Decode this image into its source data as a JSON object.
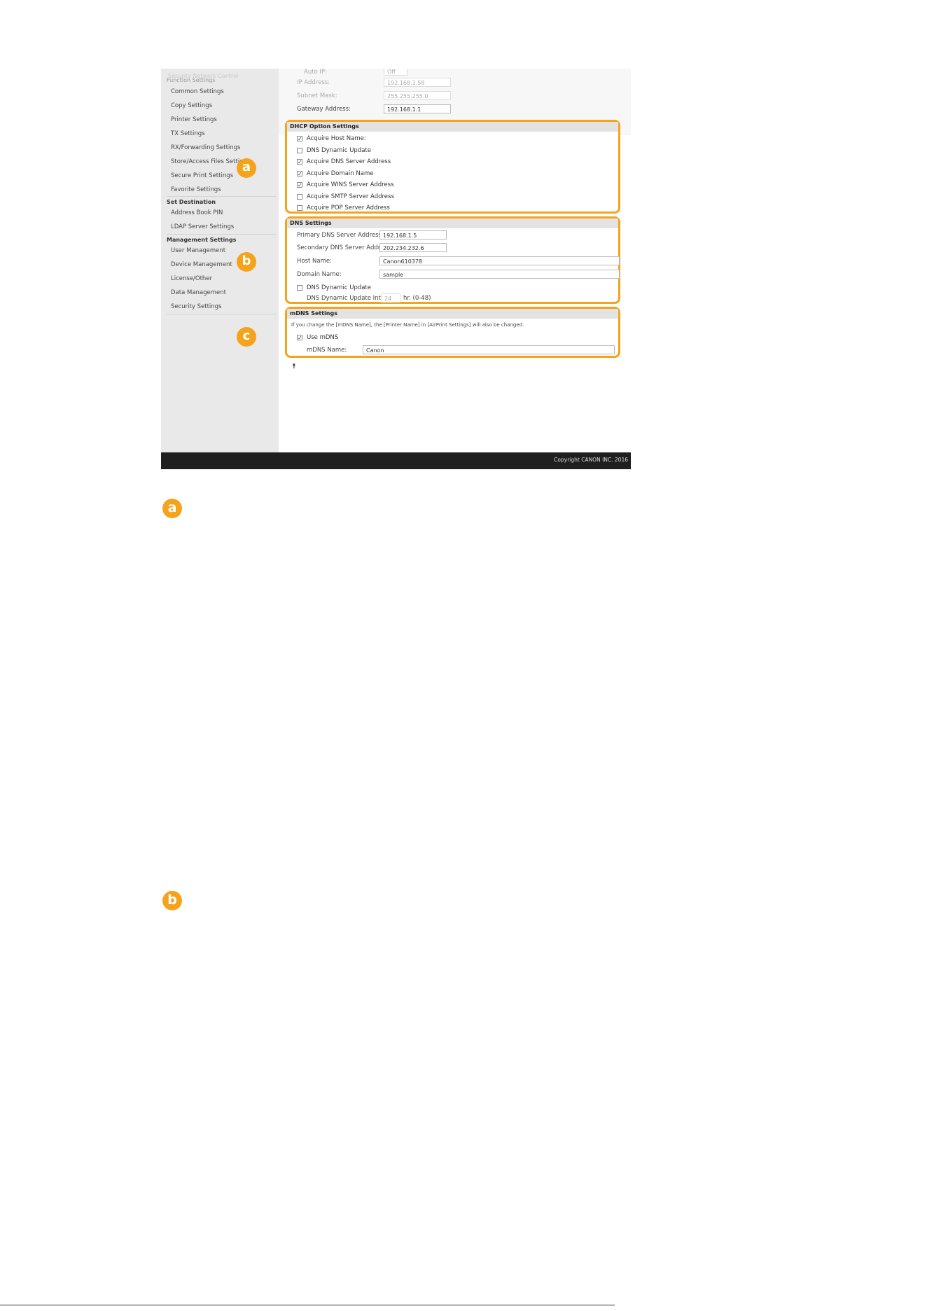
{
  "sidebar": {
    "faded_top": "Security Network Control",
    "groups": [
      {
        "header": "Function Settings",
        "dim": true,
        "items": [
          "Common Settings",
          "Copy Settings",
          "Printer Settings",
          "TX Settings",
          "RX/Forwarding Settings",
          "Store/Access Files Settings",
          "Secure Print Settings",
          "Favorite Settings"
        ]
      },
      {
        "header": "Set Destination",
        "dim": false,
        "items": [
          "Address Book PIN",
          "LDAP Server Settings"
        ]
      },
      {
        "header": "Management Settings",
        "dim": false,
        "items": [
          "User Management",
          "Device Management",
          "License/Other",
          "Data Management",
          "Security Settings"
        ]
      }
    ]
  },
  "ip_block": {
    "auto_ip_label": "Auto IP:",
    "auto_ip_value": "Off",
    "ip_address_label": "IP Address:",
    "ip_address_value": "192.168.1.58",
    "subnet_mask_label": "Subnet Mask:",
    "subnet_mask_value": "255.255.255.0",
    "gateway_label": "Gateway Address:",
    "gateway_value": "192.168.1.1"
  },
  "dhcp": {
    "badge": "a",
    "title": "DHCP Option Settings",
    "options": [
      {
        "label": "Acquire Host Name:",
        "checked": true
      },
      {
        "label": "DNS Dynamic Update",
        "checked": false
      },
      {
        "label": "Acquire DNS Server Address",
        "checked": true
      },
      {
        "label": "Acquire Domain Name",
        "checked": true
      },
      {
        "label": "Acquire WINS Server Address",
        "checked": true
      },
      {
        "label": "Acquire SMTP Server Address",
        "checked": false
      },
      {
        "label": "Acquire POP Server Address",
        "checked": false
      }
    ]
  },
  "dns": {
    "badge": "b",
    "title": "DNS Settings",
    "primary_label": "Primary DNS Server Address:",
    "primary_value": "192.168.1.5",
    "secondary_label": "Secondary DNS Server Address:",
    "secondary_value": "202.234.232.6",
    "host_label": "Host Name:",
    "host_value": "Canon610378",
    "domain_label": "Domain Name:",
    "domain_value": "sample",
    "dynamic_update_label": "DNS Dynamic Update",
    "dynamic_update_checked": false,
    "interval_label": "DNS Dynamic Update Interval:",
    "interval_value": "24",
    "interval_unit": "hr. (0-48)"
  },
  "mdns": {
    "badge": "c",
    "title": "mDNS Settings",
    "note": "If you change the [mDNS Name], the [Printer Name] in [AirPrint Settings] will also be changed.",
    "use_label": "Use mDNS",
    "use_checked": true,
    "name_label": "mDNS Name:",
    "name_value": "Canon"
  },
  "top_icon": "⯭",
  "footer": {
    "copyright": "Copyright CANON INC. 2016"
  },
  "callouts": {
    "a": "a",
    "b": "b"
  },
  "colors": {
    "accent": "#f5a31a",
    "sidebar_bg": "#e9e9e9",
    "footer_bg": "#1f1f1f"
  }
}
